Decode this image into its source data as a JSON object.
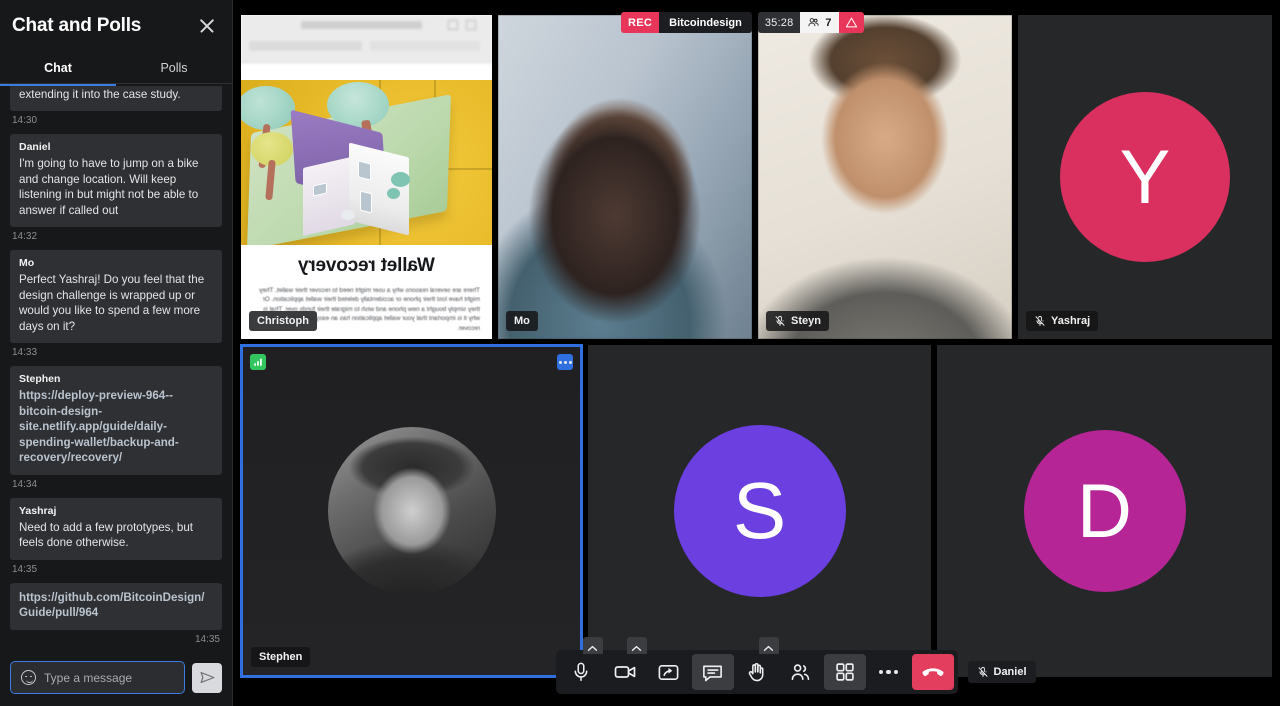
{
  "chat": {
    "title": "Chat and Polls",
    "close_icon": "close-icon",
    "tabs": [
      {
        "label": "Chat",
        "active": true
      },
      {
        "label": "Polls",
        "active": false
      }
    ],
    "messages": [
      {
        "author": "",
        "text": "Thanks Stephen. Thanks Mo! Would really love to do the call, wrapping up the design challenge doc and extending it into the case study.",
        "time": "14:30",
        "is_link": false
      },
      {
        "author": "Daniel",
        "text": "I'm going to have to jump on a bike and change location. Will keep listening in but might not be able to answer if called out",
        "time": "14:32",
        "is_link": false
      },
      {
        "author": "Mo",
        "text": "Perfect Yashraj! Do you feel that the design challenge is wrapped up or would you like to spend a few more days on it?",
        "time": "14:33",
        "is_link": false
      },
      {
        "author": "Stephen",
        "text": "https://deploy-preview-964--bitcoin-design-site.netlify.app/guide/daily-spending-wallet/backup-and-recovery/recovery/",
        "time": "14:34",
        "is_link": true
      },
      {
        "author": "Yashraj",
        "text": "Need to add a few prototypes, but feels done otherwise.",
        "time": "14:35",
        "is_link": false
      },
      {
        "author": "",
        "text": "https://github.com/BitcoinDesign/Guide/pull/964",
        "time": "14:35",
        "is_link": true
      }
    ],
    "composer": {
      "emoji_icon": "smiley-icon",
      "placeholder": "Type a message",
      "value": "",
      "send_icon": "send-icon"
    }
  },
  "status_bar": {
    "recording_label": "REC",
    "meeting_name": "Bitcoindesign",
    "elapsed": "35:28",
    "participant_icon": "people-icon",
    "participant_count": "7",
    "warning_icon": "warning-triangle-icon"
  },
  "tiles": {
    "row1": [
      {
        "name": "Christoph",
        "kind": "screenshare",
        "muted": false,
        "share": {
          "heading": "Wallet recovery",
          "paragraph": "There are several reasons why a user might need to recover their wallet. They might have lost their phone or accidentally deleted their wallet application. Or they simply bought a new phone and wish to migrate their funds over. That is why it is important that your wallet application has an easy way for users to recover."
        }
      },
      {
        "name": "Mo",
        "kind": "camera",
        "muted": false
      },
      {
        "name": "Steyn",
        "kind": "camera",
        "muted": true
      },
      {
        "name": "Yashraj",
        "kind": "avatar",
        "muted": true,
        "initial": "Y",
        "color": "#d9305f"
      }
    ],
    "row2": [
      {
        "name": "Stephen",
        "kind": "camera",
        "muted": false,
        "active_speaker": true,
        "signal_icon": "signal-strength-icon",
        "options_icon": "more-options-icon"
      },
      {
        "name": "",
        "kind": "avatar",
        "muted": false,
        "initial": "S",
        "color": "#6b3fe0"
      },
      {
        "name": "",
        "kind": "avatar",
        "muted": false,
        "initial": "D",
        "color": "#b52596"
      }
    ]
  },
  "toolbar": {
    "buttons": [
      {
        "name": "microphone-button",
        "icon": "microphone-icon",
        "active": false,
        "caret": true
      },
      {
        "name": "camera-button",
        "icon": "video-camera-icon",
        "active": false,
        "caret": true
      },
      {
        "name": "share-screen-button",
        "icon": "share-screen-icon",
        "active": false,
        "caret": false
      },
      {
        "name": "chat-button",
        "icon": "chat-bubble-icon",
        "active": true,
        "caret": false
      },
      {
        "name": "raise-hand-button",
        "icon": "raise-hand-icon",
        "active": false,
        "caret": true
      },
      {
        "name": "participants-button",
        "icon": "participants-icon",
        "active": false,
        "caret": false
      },
      {
        "name": "layout-button",
        "icon": "grid-layout-icon",
        "active": true,
        "caret": false
      },
      {
        "name": "more-button",
        "icon": "more-dots-icon",
        "active": false,
        "caret": false
      },
      {
        "name": "end-call-button",
        "icon": "end-call-icon",
        "active": false,
        "caret": false,
        "end": true
      }
    ],
    "self_name": "Daniel",
    "self_muted": true
  },
  "colors": {
    "accent_blue": "#2f6fe0",
    "danger_red": "#e8365a",
    "signal_green": "#33c55e",
    "panel_bg": "#17181a"
  }
}
